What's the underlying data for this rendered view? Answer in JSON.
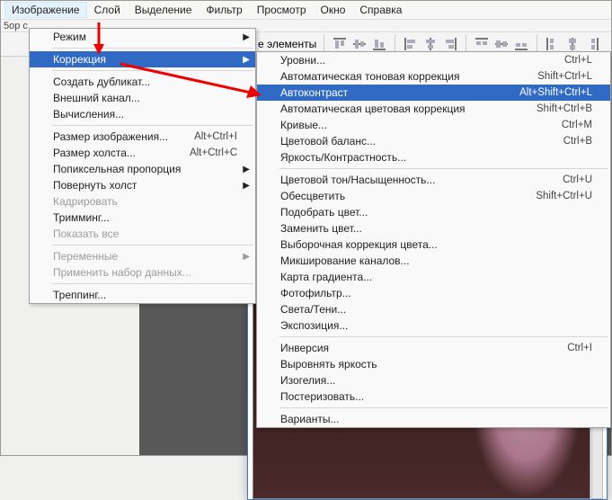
{
  "menubar": {
    "active": "Изображение",
    "items": [
      "Слой",
      "Выделение",
      "Фильтр",
      "Просмотр",
      "Окно",
      "Справка"
    ]
  },
  "top_strip": "5ор с",
  "toolbar_text": "е элементы",
  "menu1": {
    "mode": "Режим",
    "correction": "Коррекция",
    "duplicate": "Создать дубликат...",
    "apply_image": "Внешний канал...",
    "calculations": "Вычисления...",
    "image_size": {
      "label": "Размер изображения...",
      "short": "Alt+Ctrl+I"
    },
    "canvas_size": {
      "label": "Размер холста...",
      "short": "Alt+Ctrl+C"
    },
    "pixel_aspect": "Попиксельная пропорция",
    "rotate": "Повернуть холст",
    "crop": "Кадрировать",
    "trim": "Тримминг...",
    "reveal": "Показать все",
    "variables": "Переменные",
    "apply_data": "Применить набор данных...",
    "trap": "Треппинг..."
  },
  "menu2": {
    "levels": {
      "label": "Уровни...",
      "short": "Ctrl+L"
    },
    "auto_tone": {
      "label": "Автоматическая тоновая коррекция",
      "short": "Shift+Ctrl+L"
    },
    "auto_contrast": {
      "label": "Автоконтраст",
      "short": "Alt+Shift+Ctrl+L"
    },
    "auto_color": {
      "label": "Автоматическая цветовая коррекция",
      "short": "Shift+Ctrl+B"
    },
    "curves": {
      "label": "Кривые...",
      "short": "Ctrl+M"
    },
    "color_balance": {
      "label": "Цветовой баланс...",
      "short": "Ctrl+B"
    },
    "brightness": "Яркость/Контрастность...",
    "hue": {
      "label": "Цветовой тон/Насыщенность...",
      "short": "Ctrl+U"
    },
    "desaturate": {
      "label": "Обесцветить",
      "short": "Shift+Ctrl+U"
    },
    "match_color": "Подобрать цвет...",
    "replace_color": "Заменить цвет...",
    "selective": "Выборочная коррекция цвета...",
    "channel_mixer": "Микширование каналов...",
    "gradient_map": "Карта градиента...",
    "photo_filter": "Фотофильтр...",
    "shadows": "Света/Тени...",
    "exposure": "Экспозиция...",
    "invert": {
      "label": "Инверсия",
      "short": "Ctrl+I"
    },
    "equalize": "Выровнять яркость",
    "threshold": "Изогелия...",
    "posterize": "Постеризовать...",
    "variations": "Варианты..."
  }
}
